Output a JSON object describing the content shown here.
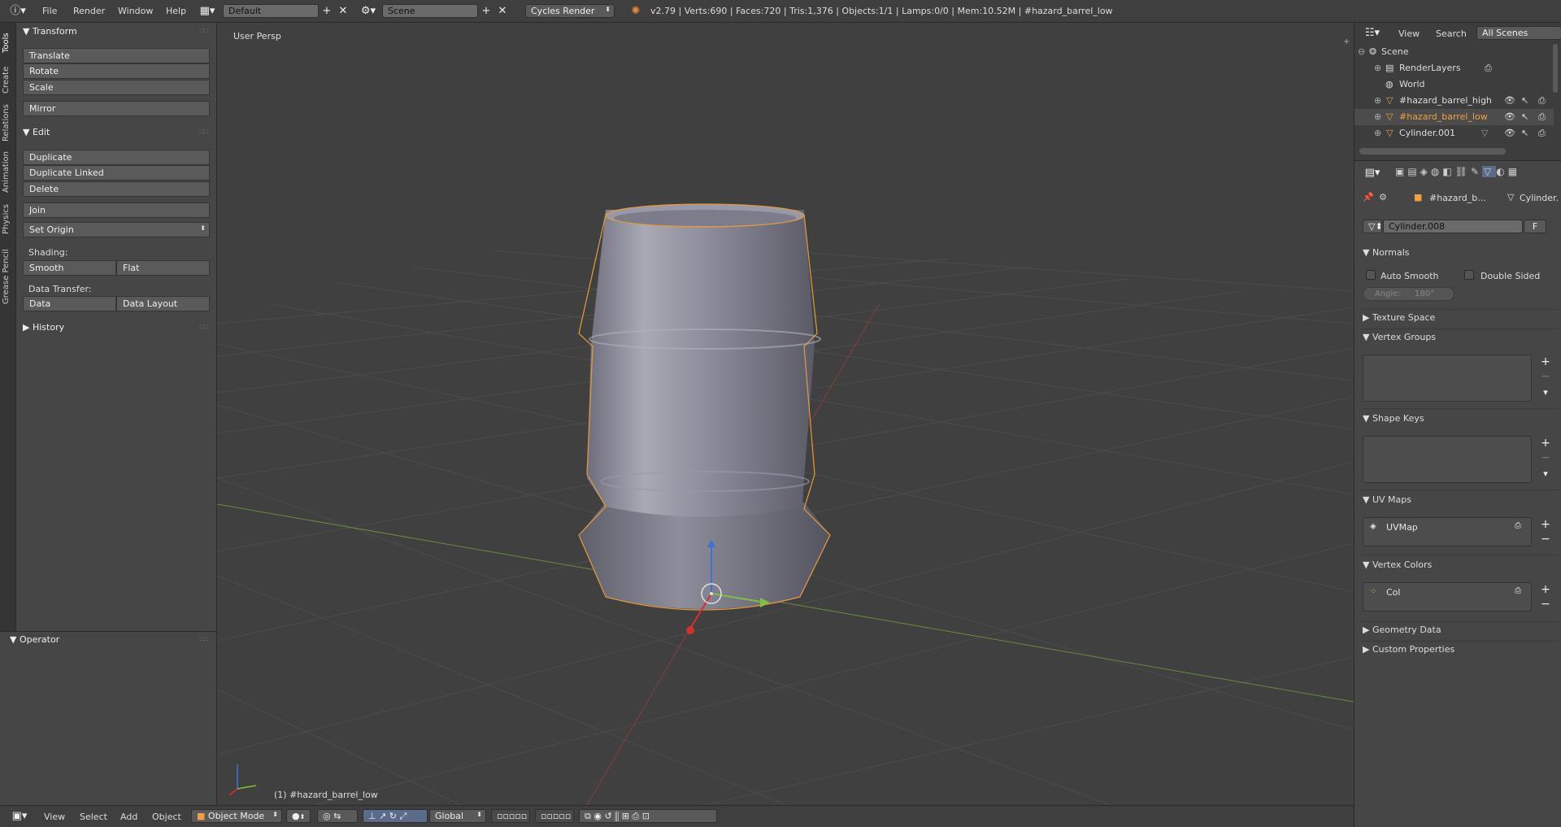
{
  "topbar": {
    "menus": [
      "File",
      "Render",
      "Window",
      "Help"
    ],
    "layout": "Default",
    "scene": "Scene",
    "engine": "Cycles Render",
    "stats": "v2.79 | Verts:690 | Faces:720 | Tris:1,376 | Objects:1/1 | Lamps:0/0 | Mem:10.52M | #hazard_barrel_low"
  },
  "tabs": [
    "Tools",
    "Create",
    "Relations",
    "Animation",
    "Physics",
    "Grease Pencil"
  ],
  "toolshelf": {
    "transform": {
      "title": "Transform",
      "buttons": [
        "Translate",
        "Rotate",
        "Scale",
        "Mirror"
      ]
    },
    "edit": {
      "title": "Edit",
      "buttons": [
        "Duplicate",
        "Duplicate Linked",
        "Delete",
        "Join",
        "Set Origin"
      ]
    },
    "shading_label": "Shading:",
    "smooth": "Smooth",
    "flat": "Flat",
    "data_transfer_label": "Data Transfer:",
    "data": "Data",
    "data_layout": "Data Layout",
    "history": "History"
  },
  "operator": {
    "title": "Operator"
  },
  "viewport": {
    "label": "User Persp",
    "object_info": "(1) #hazard_barrel_low"
  },
  "bottombar": {
    "menus": [
      "View",
      "Select",
      "Add",
      "Object"
    ],
    "mode": "Object Mode",
    "orientation": "Global"
  },
  "outliner": {
    "menus": [
      "View",
      "Search"
    ],
    "filter": "All Scenes",
    "items": [
      "Scene",
      "RenderLayers",
      "World",
      "#hazard_barrel_high",
      "#hazard_barrel_low",
      "Cylinder.001"
    ]
  },
  "properties": {
    "breadcrumb_object": "#hazard_b...",
    "breadcrumb_mesh": "Cylinder.",
    "mesh_name": "Cylinder.008",
    "fake_user": "F",
    "normals": {
      "title": "Normals",
      "auto_smooth": "Auto Smooth",
      "double_sided": "Double Sided",
      "angle_label": "Angle:",
      "angle_value": "180°"
    },
    "sections": [
      "Texture Space",
      "Vertex Groups",
      "Shape Keys",
      "UV Maps",
      "Vertex Colors",
      "Geometry Data",
      "Custom Properties"
    ],
    "uv_map": "UVMap",
    "vertex_color": "Col"
  },
  "colors": {
    "selected_orange": "#f0a040",
    "x_axis": "#d03030",
    "y_axis": "#80c040",
    "z_axis": "#4070d0"
  }
}
